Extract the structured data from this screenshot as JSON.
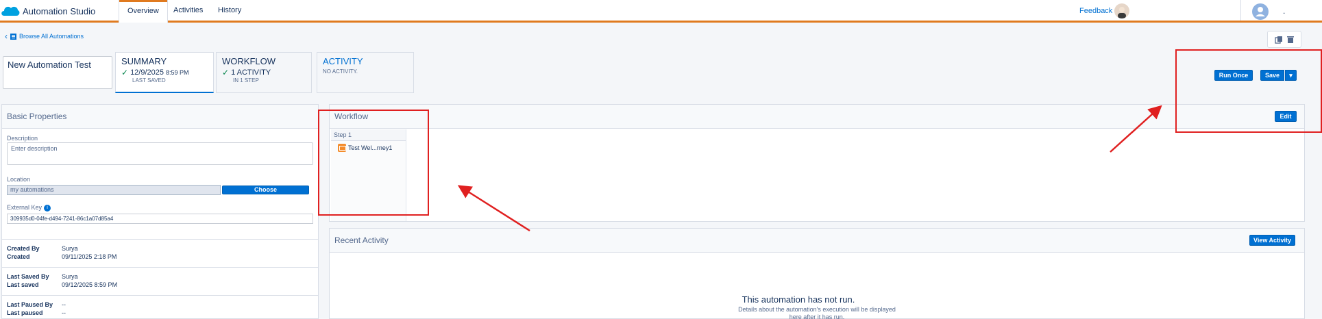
{
  "header": {
    "app_title": "Automation Studio",
    "tabs": [
      {
        "label": "Overview",
        "active": true
      },
      {
        "label": "Activities",
        "active": false
      },
      {
        "label": "History",
        "active": false
      }
    ],
    "feedback": "Feedback",
    "user_initial": "."
  },
  "breadcrumb": "Browse All Automations",
  "automation_name": "New Automation Test",
  "summary_cards": {
    "summary": {
      "title": "SUMMARY",
      "date": "12/9/2025",
      "time": "8:59 PM",
      "sub": "LAST SAVED"
    },
    "workflow": {
      "title": "WORKFLOW",
      "line": "1 ACTIVITY",
      "sub": "IN 1 STEP"
    },
    "activity": {
      "title": "ACTIVITY",
      "line": "NO ACTIVITY."
    }
  },
  "actions": {
    "run_once": "Run Once",
    "save": "Save",
    "save_menu": "▾"
  },
  "basic_properties": {
    "title": "Basic Properties",
    "description_label": "Description",
    "description_placeholder": "Enter description",
    "location_label": "Location",
    "location_value": "my automations",
    "choose_button": "Choose",
    "external_key_label": "External Key",
    "external_key_value": "309935d0-04fe-d494-7241-86c1a07d85a4"
  },
  "meta": [
    [
      {
        "k": "Created By",
        "v": "Surya"
      },
      {
        "k": "Created",
        "v": "09/11/2025 2:18 PM"
      }
    ],
    [
      {
        "k": "Last Saved By",
        "v": "Surya"
      },
      {
        "k": "Last saved",
        "v": "09/12/2025 8:59 PM"
      }
    ],
    [
      {
        "k": "Last Paused By",
        "v": "--"
      },
      {
        "k": "Last paused",
        "v": "--"
      }
    ]
  ],
  "workflow": {
    "title": "Workflow",
    "edit_button": "Edit",
    "step_label": "Step 1",
    "activity_name": "Test Wel...rney1"
  },
  "recent_activity": {
    "title": "Recent Activity",
    "view_button": "View Activity",
    "empty_title": "This automation has not run.",
    "empty_sub_1": "Details about the automation's execution will be displayed",
    "empty_sub_2": "here after it has run."
  },
  "colors": {
    "accent": "#0070d2",
    "header_bar": "#e07a1f",
    "annotation": "#e02020"
  }
}
